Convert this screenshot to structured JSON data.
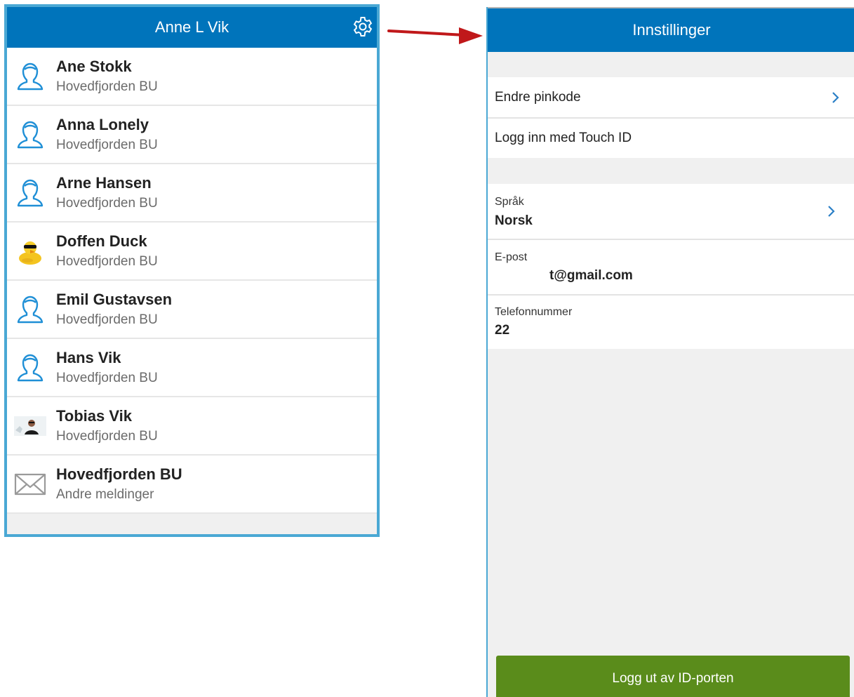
{
  "left_app": {
    "header_title": "Anne L Vik",
    "settings_icon": "gear-icon",
    "contacts": [
      {
        "name": "Ane Stokk",
        "subtitle": "Hovedfjorden BU",
        "avatar": "person-outline-icon"
      },
      {
        "name": "Anna Lonely",
        "subtitle": "Hovedfjorden BU",
        "avatar": "person-outline-icon"
      },
      {
        "name": "Arne Hansen",
        "subtitle": "Hovedfjorden BU",
        "avatar": "person-outline-icon"
      },
      {
        "name": "Doffen Duck",
        "subtitle": "Hovedfjorden BU",
        "avatar": "duck-photo"
      },
      {
        "name": "Emil Gustavsen",
        "subtitle": "Hovedfjorden BU",
        "avatar": "person-outline-icon"
      },
      {
        "name": "Hans Vik",
        "subtitle": "Hovedfjorden BU",
        "avatar": "person-outline-icon"
      },
      {
        "name": "Tobias Vik",
        "subtitle": "Hovedfjorden BU",
        "avatar": "person-photo"
      },
      {
        "name": "Hovedfjorden BU",
        "subtitle": "Andre meldinger",
        "avatar": "envelope-icon"
      }
    ]
  },
  "settings": {
    "header_title": "Innstillinger",
    "change_pin_label": "Endre pinkode",
    "touch_id_label": "Logg inn med Touch ID",
    "language_label": "Språk",
    "language_value": "Norsk",
    "email_label": "E-post",
    "email_value": "t@gmail.com",
    "phone_label": "Telefonnummer",
    "phone_value": "22",
    "logout_label": "Logg ut av ID-porten"
  },
  "colors": {
    "header_blue": "#0074bb",
    "frame_blue": "#4aa8d4",
    "logout_green": "#5a8c1b",
    "arrow_red": "#c0181a",
    "chevron_blue": "#2a7fc6"
  }
}
